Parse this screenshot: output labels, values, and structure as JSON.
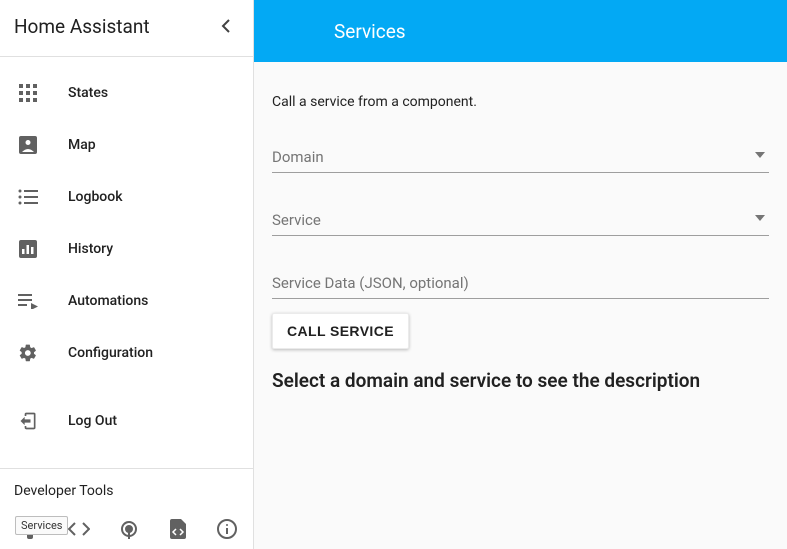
{
  "sidebar": {
    "title": "Home Assistant",
    "items": [
      {
        "label": "States"
      },
      {
        "label": "Map"
      },
      {
        "label": "Logbook"
      },
      {
        "label": "History"
      },
      {
        "label": "Automations"
      },
      {
        "label": "Configuration"
      },
      {
        "label": "Log Out"
      }
    ],
    "devTitle": "Developer Tools",
    "tooltip": "Services"
  },
  "appbar": {
    "title": "Services"
  },
  "content": {
    "intro": "Call a service from a component.",
    "domainField": "Domain",
    "serviceField": "Service",
    "serviceDataField": "Service Data (JSON, optional)",
    "callButton": "CALL SERVICE",
    "description": "Select a domain and service to see the description"
  }
}
